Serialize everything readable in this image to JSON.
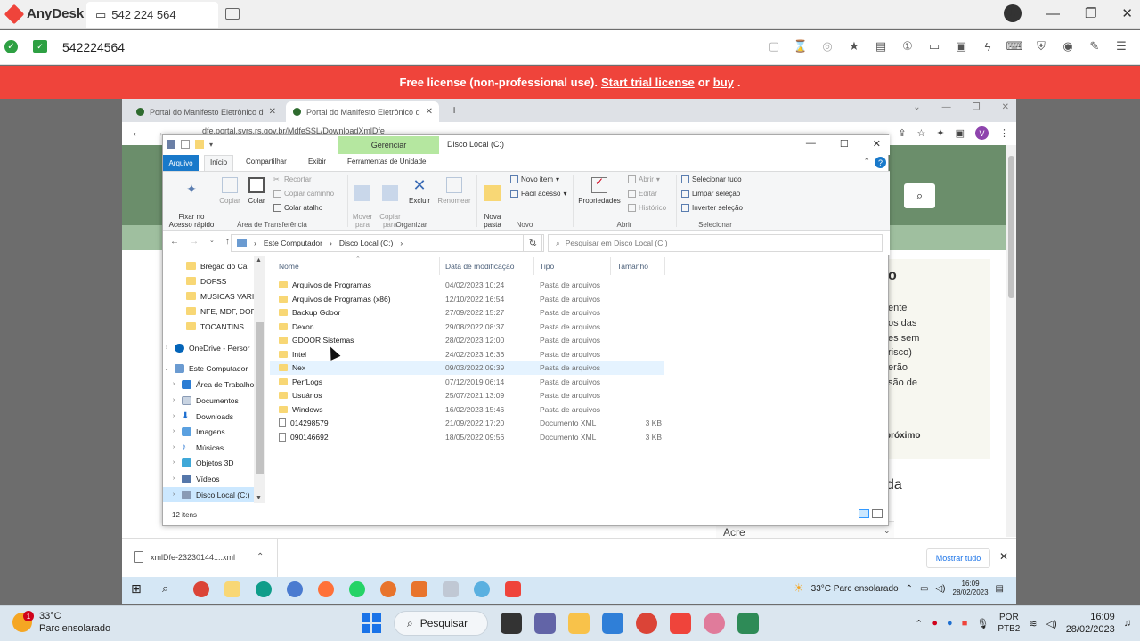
{
  "anydesk": {
    "app_name": "AnyDesk",
    "tab_label": "542 224 564",
    "session_id": "542224564",
    "banner": {
      "text": "Free license (non-professional use).",
      "trial_link": "Start trial license",
      "or": "or",
      "buy_link": "buy",
      "end": "."
    }
  },
  "chrome": {
    "tabs": [
      {
        "label": "Portal do Manifesto Eletrônico d"
      },
      {
        "label": "Portal do Manifesto Eletrônico d"
      }
    ],
    "avatar_letter": "V",
    "url_partial": "dfe.portal.svrs.rs.gov.br/MdfeSSL/DownloadXmlDfe"
  },
  "webpage": {
    "heading_fragment": "o",
    "lines": [
      "ente",
      "os das",
      "es sem",
      "risco)",
      "erão",
      "são de"
    ],
    "proximo": "próximo",
    "da_fragment": "da",
    "state_select": "Acre"
  },
  "download_bar": {
    "file": "xmlDfe-23230144....xml",
    "show_all": "Mostrar tudo"
  },
  "explorer": {
    "context_tab": "Gerenciar",
    "title": "Disco Local (C:)",
    "ribbon_tabs": [
      "Arquivo",
      "Início",
      "Compartilhar",
      "Exibir",
      "Ferramentas de Unidade"
    ],
    "ribbon": {
      "pin": "Fixar no\nAcesso rápido",
      "copy": "Copiar",
      "paste": "Colar",
      "cut": "Recortar",
      "copy_path": "Copiar caminho",
      "paste_shortcut": "Colar atalho",
      "group_clipboard": "Área de Transferência",
      "move_to": "Mover\npara",
      "copy_to": "Copiar\npara",
      "delete": "Excluir",
      "rename": "Renomear",
      "group_organize": "Organizar",
      "new_folder": "Nova\npasta",
      "new_item": "Novo item",
      "easy_access": "Fácil acesso",
      "group_new": "Novo",
      "properties": "Propriedades",
      "open": "Abrir",
      "edit": "Editar",
      "history": "Histórico",
      "group_open": "Abrir",
      "select_all": "Selecionar tudo",
      "select_none": "Limpar seleção",
      "invert_selection": "Inverter seleção",
      "group_select": "Selecionar"
    },
    "path": [
      "Este Computador",
      "Disco Local (C:)"
    ],
    "search_placeholder": "Pesquisar em Disco Local (C:)",
    "nav": [
      {
        "label": "Bregão do Ca",
        "type": "folder"
      },
      {
        "label": "DOFSS",
        "type": "folder"
      },
      {
        "label": "MUSICAS VARIA",
        "type": "folder"
      },
      {
        "label": "NFE, MDF, DOF",
        "type": "folder"
      },
      {
        "label": "TOCANTINS",
        "type": "folder"
      },
      {
        "label": "OneDrive - Persor",
        "type": "onedrive"
      },
      {
        "label": "Este Computador",
        "type": "pc"
      },
      {
        "label": "Área de Trabalho",
        "type": "desktop"
      },
      {
        "label": "Documentos",
        "type": "docs"
      },
      {
        "label": "Downloads",
        "type": "downloads"
      },
      {
        "label": "Imagens",
        "type": "images"
      },
      {
        "label": "Músicas",
        "type": "music"
      },
      {
        "label": "Objetos 3D",
        "type": "3d"
      },
      {
        "label": "Vídeos",
        "type": "videos"
      },
      {
        "label": "Disco Local (C:)",
        "type": "drive"
      }
    ],
    "columns": [
      "Nome",
      "Data de modificação",
      "Tipo",
      "Tamanho"
    ],
    "files": [
      {
        "name": "Arquivos de Programas",
        "date": "04/02/2023 10:24",
        "type": "Pasta de arquivos",
        "size": "",
        "kind": "folder"
      },
      {
        "name": "Arquivos de Programas (x86)",
        "date": "12/10/2022 16:54",
        "type": "Pasta de arquivos",
        "size": "",
        "kind": "folder"
      },
      {
        "name": "Backup Gdoor",
        "date": "27/09/2022 15:27",
        "type": "Pasta de arquivos",
        "size": "",
        "kind": "folder"
      },
      {
        "name": "Dexon",
        "date": "29/08/2022 08:37",
        "type": "Pasta de arquivos",
        "size": "",
        "kind": "folder"
      },
      {
        "name": "GDOOR Sistemas",
        "date": "28/02/2023 12:00",
        "type": "Pasta de arquivos",
        "size": "",
        "kind": "folder"
      },
      {
        "name": "Intel",
        "date": "24/02/2023 16:36",
        "type": "Pasta de arquivos",
        "size": "",
        "kind": "folder"
      },
      {
        "name": "Nex",
        "date": "09/03/2022 09:39",
        "type": "Pasta de arquivos",
        "size": "",
        "kind": "folder"
      },
      {
        "name": "PerfLogs",
        "date": "07/12/2019 06:14",
        "type": "Pasta de arquivos",
        "size": "",
        "kind": "folder"
      },
      {
        "name": "Usuários",
        "date": "25/07/2021 13:09",
        "type": "Pasta de arquivos",
        "size": "",
        "kind": "folder"
      },
      {
        "name": "Windows",
        "date": "16/02/2023 15:46",
        "type": "Pasta de arquivos",
        "size": "",
        "kind": "folder"
      },
      {
        "name": "014298579",
        "date": "21/09/2022 17:20",
        "type": "Documento XML",
        "size": "3 KB",
        "kind": "xml"
      },
      {
        "name": "090146692",
        "date": "18/05/2022 09:56",
        "type": "Documento XML",
        "size": "3 KB",
        "kind": "xml"
      }
    ],
    "status": "12 itens"
  },
  "remote_taskbar": {
    "weather": "33°C  Parc ensolarado",
    "time": "16:09",
    "date": "28/02/2023"
  },
  "local_taskbar": {
    "temp": "33°C",
    "condition": "Parc ensolarado",
    "badge": "1",
    "search": "Pesquisar",
    "lang1": "POR",
    "lang2": "PTB2",
    "time": "16:09",
    "date": "28/02/2023"
  }
}
